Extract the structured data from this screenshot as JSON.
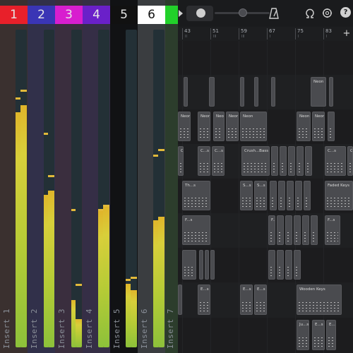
{
  "mixer": {
    "channels": [
      {
        "number": "1",
        "label": "Insert 1",
        "color": "#e8202a",
        "bg": "#3a302f",
        "level": 0.74,
        "peak": 0.78
      },
      {
        "number": "2",
        "label": "Insert 2",
        "color": "#3a35b5",
        "bg": "#31304a",
        "level": 0.48,
        "peak": 0.67
      },
      {
        "number": "3",
        "label": "Insert 3",
        "color": "#d81ecf",
        "bg": "#3a2e3e",
        "level": 0.15,
        "peak": 0.43
      },
      {
        "number": "4",
        "label": "Insert 4",
        "color": "#6a20c9",
        "bg": "#352e46",
        "level": 0.43,
        "peak": 0.43
      },
      {
        "number": "5",
        "label": "Insert 5",
        "color": "#111111",
        "bg": "#111214",
        "level": 0.2,
        "peak": 0.21
      },
      {
        "number": "6",
        "label": "Insert 6",
        "color": "#ffffff",
        "bg": "#3a3d40",
        "level": 0.4,
        "peak": 0.6
      },
      {
        "number": "",
        "label": "Insert 7",
        "color": "#22d12a",
        "bg": "#2c3d2c",
        "level": 0,
        "peak": 0
      }
    ]
  },
  "transport": {
    "play_icon": "play-icon",
    "record_icon": "record-icon",
    "metronome_icon": "metronome-icon",
    "omega_icon": "omega-icon",
    "settings_icon": "gear-icon",
    "help_icon": "help-icon",
    "add_icon": "plus-icon",
    "help_glyph": "?",
    "add_glyph": "+"
  },
  "ruler": {
    "bars": [
      "43",
      "51",
      "59",
      "67",
      "75",
      "83"
    ],
    "subs": [
      "II",
      "III",
      "III",
      "I",
      "I",
      "I"
    ]
  },
  "arrangement": {
    "lanes": [
      {
        "clips": []
      },
      {
        "clips": [
          {
            "name": ""
          },
          {
            "name": ""
          },
          {
            "name": ""
          },
          {
            "name": ""
          },
          {
            "name": ""
          },
          {
            "name": "Neon"
          },
          {
            "name": ""
          }
        ]
      },
      {
        "clips": [
          {
            "name": "Neon"
          },
          {
            "name": "Neon"
          },
          {
            "name": "Neon"
          },
          {
            "name": "Neon"
          },
          {
            "name": "Neon"
          },
          {
            "name": "Neon"
          },
          {
            "name": "Neon"
          },
          {
            "name": ""
          }
        ]
      },
      {
        "clips": [
          {
            "name": "C...s"
          },
          {
            "name": "C...s"
          },
          {
            "name": "C...s"
          },
          {
            "name": "Crush...Bass"
          },
          {
            "name": ""
          },
          {
            "name": ""
          },
          {
            "name": ""
          },
          {
            "name": ""
          },
          {
            "name": ""
          },
          {
            "name": "C...s"
          },
          {
            "name": "Crush...Bass"
          }
        ]
      },
      {
        "clips": [
          {
            "name": "Th...s"
          },
          {
            "name": "S...s"
          },
          {
            "name": "S...s"
          },
          {
            "name": ""
          },
          {
            "name": ""
          },
          {
            "name": ""
          },
          {
            "name": ""
          },
          {
            "name": ""
          },
          {
            "name": "Faded Keys"
          }
        ]
      },
      {
        "clips": [
          {
            "name": "F...s"
          },
          {
            "name": "F...s"
          },
          {
            "name": ""
          },
          {
            "name": ""
          },
          {
            "name": ""
          },
          {
            "name": ""
          },
          {
            "name": ""
          },
          {
            "name": "F...s"
          }
        ]
      },
      {
        "clips": [
          {
            "name": ""
          },
          {
            "name": ""
          },
          {
            "name": ""
          },
          {
            "name": ""
          },
          {
            "name": ""
          },
          {
            "name": ""
          },
          {
            "name": ""
          },
          {
            "name": ""
          }
        ]
      },
      {
        "clips": [
          {
            "name": ""
          },
          {
            "name": "E...s"
          },
          {
            "name": "E...s"
          },
          {
            "name": "E...s"
          },
          {
            "name": "Wooden Keys"
          }
        ]
      },
      {
        "clips": [
          {
            "name": "Ju...s"
          },
          {
            "name": "E...s"
          },
          {
            "name": "E...s"
          }
        ]
      }
    ]
  }
}
